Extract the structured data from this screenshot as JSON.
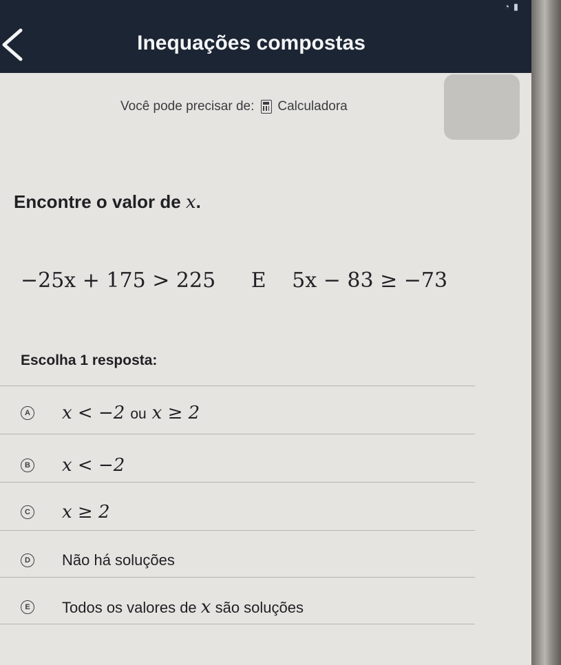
{
  "header": {
    "title": "Inequações compostas"
  },
  "hint": {
    "prefix": "Você pode precisar de:",
    "tool_label": "Calculadora"
  },
  "question": {
    "prompt": "Encontre o valor de",
    "variable": "x",
    "punct": "."
  },
  "math": {
    "left": "−25x + 175 > 225",
    "conjunction": "E",
    "right": "5x − 83 ≥ −73"
  },
  "answers": {
    "heading": "Escolha 1 resposta:",
    "options": [
      {
        "letter": "A",
        "part1": "x < −2",
        "connector": "ou",
        "part2": "x ≥ 2"
      },
      {
        "letter": "B",
        "expr": "x < −2"
      },
      {
        "letter": "C",
        "expr": "x ≥ 2"
      },
      {
        "letter": "D",
        "text": "Não há soluções"
      },
      {
        "letter": "E",
        "pre": "Todos os valores de",
        "var": "x",
        "post": "são soluções"
      }
    ]
  },
  "icons": {
    "back": "chevron-left-icon",
    "calculator": "calculator-icon"
  },
  "colors": {
    "header_bg": "#1c2533",
    "screen_bg": "#e6e4e1"
  }
}
